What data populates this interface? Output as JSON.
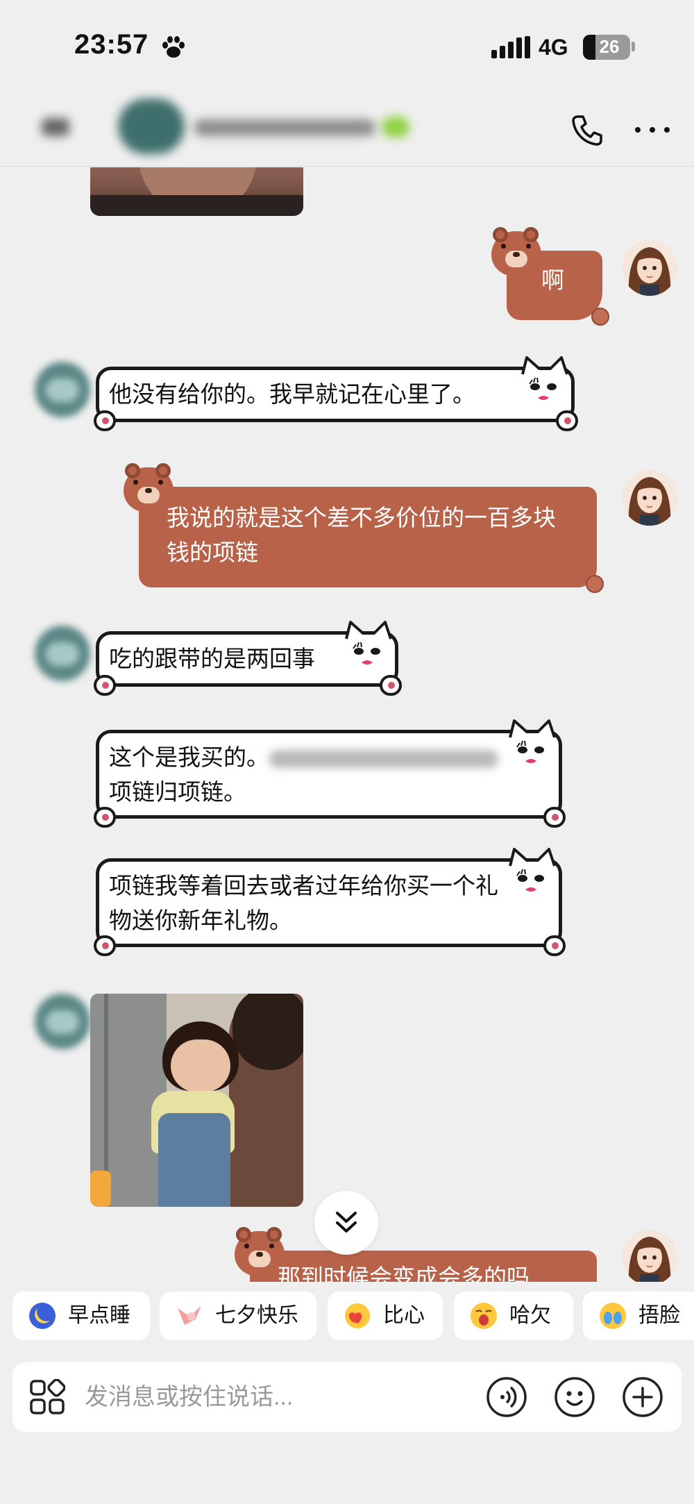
{
  "status_bar": {
    "time": "23:57",
    "network": "4G",
    "battery": "26"
  },
  "nav": {
    "icons": [
      "back-icon",
      "phone-icon",
      "more-icon"
    ]
  },
  "messages": [
    {
      "sender": "me",
      "type": "text",
      "text": "啊"
    },
    {
      "sender": "other",
      "type": "text",
      "text": "他没有给你的。我早就记在心里了。"
    },
    {
      "sender": "me",
      "type": "text",
      "text": "我说的就是这个差不多价位的一百多块钱的项链"
    },
    {
      "sender": "other",
      "type": "text",
      "text": "吃的跟带的是两回事"
    },
    {
      "sender": "other",
      "type": "text",
      "line1": "这个是我买的。",
      "line2": "项链归项链。"
    },
    {
      "sender": "other",
      "type": "text",
      "text": "项链我等着回去或者过年给你买一个礼物送你新年礼物。"
    },
    {
      "sender": "other",
      "type": "image",
      "icon": "photo-image"
    },
    {
      "sender": "me",
      "type": "text",
      "text": "那到时候会变成会多的吗"
    }
  ],
  "quick_replies": [
    {
      "label": "早点睡",
      "icon": "moon-emoji-icon"
    },
    {
      "label": "七夕快乐",
      "icon": "bird-emoji-icon"
    },
    {
      "label": "比心",
      "icon": "heart-hands-emoji-icon"
    },
    {
      "label": "哈欠",
      "icon": "yawn-emoji-icon"
    },
    {
      "label": "捂脸",
      "icon": "facepalm-emoji-icon"
    }
  ],
  "input": {
    "placeholder": "发消息或按住说话..."
  },
  "colors": {
    "background": "#efefef",
    "bear_bubble": "#b86249",
    "cat_bubble_border": "#1a1a1a"
  }
}
